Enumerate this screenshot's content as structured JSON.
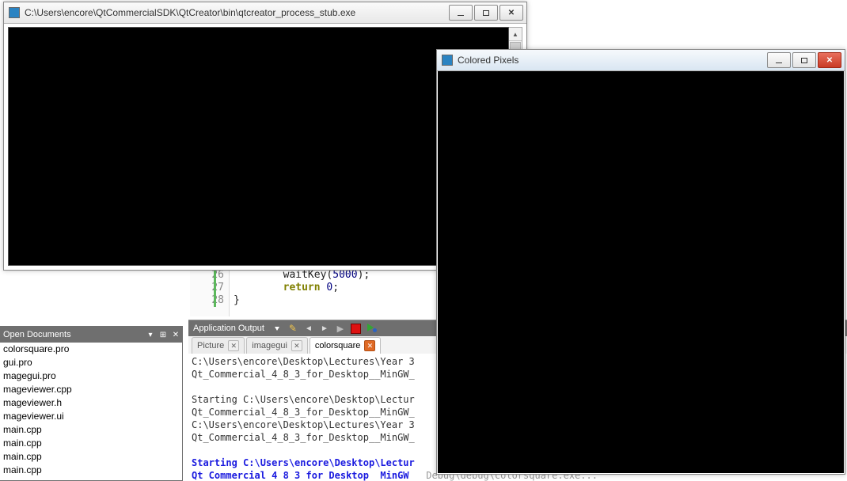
{
  "stubWindow": {
    "title": "C:\\Users\\encore\\QtCommercialSDK\\QtCreator\\bin\\qtcreator_process_stub.exe",
    "closeGlyph": "✕"
  },
  "pixelsWindow": {
    "title": "Colored Pixels",
    "closeGlyph": "✕"
  },
  "editor": {
    "lineNumbers": [
      "26",
      "27",
      "28"
    ],
    "line1_indent": "        ",
    "line1_call": "waitKey",
    "line1_arg": "(",
    "line1_num": "5000",
    "line1_end": ");",
    "line2_indent": "        ",
    "line2_kw": "return",
    "line2_space": " ",
    "line2_num": "0",
    "line2_end": ";",
    "line3": "}"
  },
  "openDocuments": {
    "title": "Open Documents",
    "dropdownGlyph": "▾",
    "splitGlyph": "⊞",
    "closeGlyph": "✕",
    "items": [
      "colorsquare.pro",
      "gui.pro",
      "magegui.pro",
      "mageviewer.cpp",
      "mageviewer.h",
      "mageviewer.ui",
      "main.cpp",
      "main.cpp",
      "main.cpp",
      "main.cpp"
    ]
  },
  "appOutput": {
    "title": "Application Output",
    "tabs": [
      {
        "label": "Picture",
        "active": false,
        "closeStyle": "gray"
      },
      {
        "label": "imagegui",
        "active": false,
        "closeStyle": "gray"
      },
      {
        "label": "colorsquare",
        "active": true,
        "closeStyle": "orange"
      }
    ],
    "lines": [
      {
        "text": "C:\\Users\\encore\\Desktop\\Lectures\\Year 3",
        "cls": ""
      },
      {
        "text": "Qt_Commercial_4_8_3_for_Desktop__MinGW_",
        "cls": ""
      },
      {
        "text": "",
        "cls": ""
      },
      {
        "text": "Starting C:\\Users\\encore\\Desktop\\Lectur",
        "cls": ""
      },
      {
        "text": "Qt_Commercial_4_8_3_for_Desktop__MinGW_",
        "cls": ""
      },
      {
        "text": "C:\\Users\\encore\\Desktop\\Lectures\\Year 3",
        "cls": ""
      },
      {
        "text": "Qt_Commercial_4_8_3_for_Desktop__MinGW_",
        "cls": ""
      },
      {
        "text": "",
        "cls": ""
      },
      {
        "text": "Starting C:\\Users\\encore\\Desktop\\Lectur",
        "cls": "blue"
      },
      {
        "text": "Qt Commercial 4 8 3 for Desktop  MinGW ",
        "cls": "blue"
      }
    ],
    "trailing": "  Debug\\debug\\colorsquare.exe..."
  },
  "scroll": {
    "up": "▲",
    "down": "▼"
  }
}
